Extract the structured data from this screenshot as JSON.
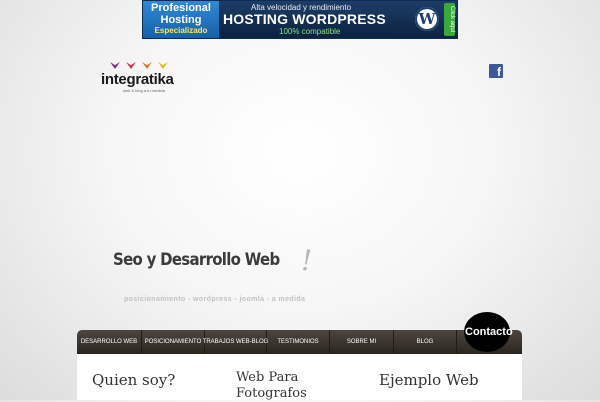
{
  "banner": {
    "left_line1": "Profesional",
    "left_line2": "Hosting",
    "left_line3": "Especializado",
    "subtitle": "Alta velocidad y rendimiento",
    "headline": "HOSTING WORDPRESS",
    "compat": "100% compatible",
    "wp_icon": "wordpress-icon",
    "click_label": "Click aquí"
  },
  "logo": {
    "name": "integratika",
    "tagline": "web & blog a tu medida",
    "bird_colors": [
      "#8a2e7c",
      "#d1315a",
      "#e8771f",
      "#f1b51c"
    ]
  },
  "social": {
    "facebook_icon": "facebook-icon",
    "facebook_glyph": "f"
  },
  "hero": {
    "slogan": "Seo y Desarrollo Web",
    "slogan_mark": "!",
    "tagline": "posicionamiento - wordpress - joomla - a medida"
  },
  "nav": {
    "items": [
      {
        "label": "DESARROLLO WEB"
      },
      {
        "label": "POSICIONAMIENTO"
      },
      {
        "label": "TRABAJOS WEB-BLOG"
      },
      {
        "label": "TESTIMONIOS"
      },
      {
        "label": "SOBRE MI"
      },
      {
        "label": "BLOG"
      },
      {
        "label": ""
      }
    ],
    "contact_label": "Contacto"
  },
  "content": {
    "columns": [
      {
        "title": "Quien soy?"
      },
      {
        "title": "Web Para Fotografos"
      },
      {
        "title": "Ejemplo Web"
      }
    ]
  },
  "colors": {
    "nav_bg": "#3a332d",
    "contact_bg": "#000000",
    "banner_blue": "#1660aa",
    "banner_navy": "#0b2240",
    "facebook_blue": "#3b5998"
  }
}
